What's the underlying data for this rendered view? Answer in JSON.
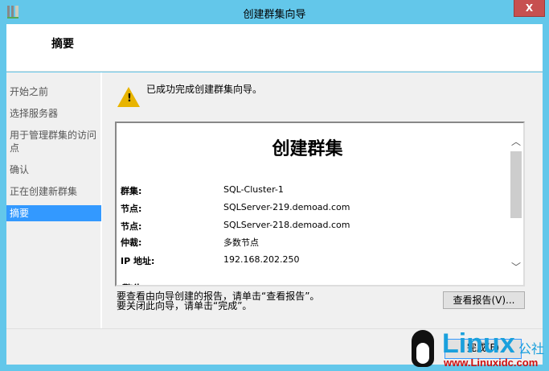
{
  "window": {
    "title": "创建群集向导",
    "close": "X"
  },
  "header": {
    "title": "摘要"
  },
  "sidebar": {
    "items": [
      {
        "label": "开始之前"
      },
      {
        "label": "选择服务器"
      },
      {
        "label": "用于管理群集的访问点"
      },
      {
        "label": "确认"
      },
      {
        "label": "正在创建新群集"
      },
      {
        "label": "摘要"
      }
    ]
  },
  "main": {
    "success": "已成功完成创建群集向导。",
    "report": {
      "title": "创建群集",
      "rows": [
        {
          "k": "群集:",
          "v": "SQL-Cluster-1"
        },
        {
          "k": "节点:",
          "v": "SQLServer-219.demoad.com"
        },
        {
          "k": "节点:",
          "v": "SQLServer-218.demoad.com"
        },
        {
          "k": "仲裁:",
          "v": "多数节点"
        },
        {
          "k": "IP 地址:",
          "v": "192.168.202.250"
        }
      ],
      "next_heading": "警告"
    },
    "hint1": "要查看由向导创建的报告，请单击“查看报告”。",
    "hint2": "要关闭此向导，请单击“完成”。",
    "view_report": "查看报告(V)...",
    "finish": "完成(F)"
  },
  "watermark": {
    "brand": "Linux",
    "cn": "公社",
    "url": "www.Linuxidc.com"
  }
}
